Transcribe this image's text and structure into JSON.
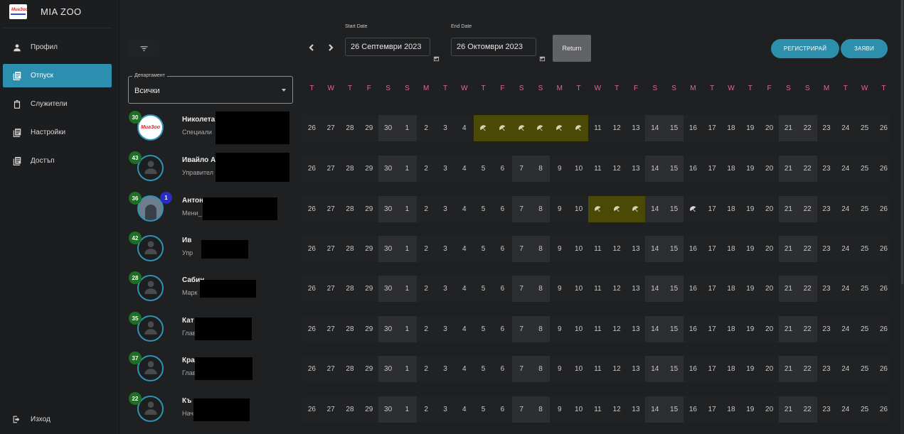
{
  "app": {
    "name": "MIA ZOO",
    "logo_text": "МиаЗоо"
  },
  "sidebar": {
    "items": [
      {
        "label": "Профил",
        "icon": "person-icon",
        "active": false
      },
      {
        "label": "Отпуск",
        "icon": "list-icon",
        "active": true
      },
      {
        "label": "Служители",
        "icon": "clipboard-icon",
        "active": false
      },
      {
        "label": "Настройки",
        "icon": "list-icon",
        "active": false
      },
      {
        "label": "Достъп",
        "icon": "list-icon",
        "active": false
      }
    ],
    "logout_label": "Изход"
  },
  "toolbar": {
    "start_date_label": "Start Date",
    "start_date_value": "26 Септември 2023",
    "end_date_label": "End Date",
    "end_date_value": "26 Октомври 2023",
    "return_label": "Return",
    "register_label": "РЕГИСТРИРАЙ",
    "request_label": "ЗАЯВИ"
  },
  "department": {
    "label": "Департамент",
    "value": "Всички"
  },
  "calendar": {
    "weekdays": [
      "T",
      "W",
      "T",
      "F",
      "S",
      "S",
      "M",
      "T",
      "W",
      "T",
      "F",
      "S",
      "S",
      "M",
      "T",
      "W",
      "T",
      "F",
      "S",
      "S",
      "M",
      "T",
      "W",
      "T",
      "F",
      "S",
      "S",
      "M",
      "T",
      "W",
      "T"
    ],
    "days": [
      "26",
      "27",
      "28",
      "29",
      "30",
      "1",
      "2",
      "3",
      "4",
      "5",
      "6",
      "7",
      "8",
      "9",
      "10",
      "11",
      "12",
      "13",
      "14",
      "15",
      "16",
      "17",
      "18",
      "19",
      "20",
      "21",
      "22",
      "23",
      "24",
      "25",
      "26"
    ],
    "weekend_indices": [
      4,
      5,
      11,
      12,
      18,
      19,
      25,
      26
    ]
  },
  "employees": [
    {
      "name": "Николета",
      "role": "Специали",
      "leave_days": "30",
      "avatar": "logo",
      "vacation_indices": [
        9,
        10,
        11,
        12,
        13,
        14
      ],
      "plain_vacation_indices": []
    },
    {
      "name": "Ивайло А",
      "role": "Управител",
      "leave_days": "43",
      "avatar": "default",
      "vacation_indices": [],
      "plain_vacation_indices": []
    },
    {
      "name": "Антон",
      "role": "Мени_",
      "leave_days": "36",
      "avatar": "photo",
      "badge": "1",
      "vacation_indices": [
        15,
        16,
        17
      ],
      "plain_vacation_indices": [
        20
      ]
    },
    {
      "name": "Ив",
      "role": "Упр",
      "leave_days": "42",
      "avatar": "default",
      "vacation_indices": [],
      "plain_vacation_indices": []
    },
    {
      "name": "Сабин",
      "role": "Марк",
      "leave_days": "28",
      "avatar": "default",
      "vacation_indices": [],
      "plain_vacation_indices": []
    },
    {
      "name": "Кат",
      "role": "Глав",
      "leave_days": "35",
      "avatar": "default",
      "vacation_indices": [],
      "plain_vacation_indices": []
    },
    {
      "name": "Кра",
      "role": "Глав",
      "leave_days": "37",
      "avatar": "default",
      "vacation_indices": [],
      "plain_vacation_indices": []
    },
    {
      "name": "Къ",
      "role": "Нач",
      "leave_days": "22",
      "avatar": "default",
      "vacation_indices": [],
      "plain_vacation_indices": []
    }
  ]
}
